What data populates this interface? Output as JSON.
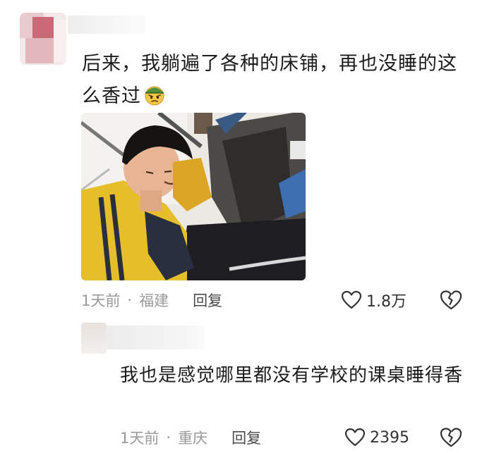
{
  "comment1": {
    "text": "后来，我躺遍了各种的床铺，再也没睡的这么香过",
    "emoji_icon": "smirk-cap-emoji-icon",
    "time": "1天前",
    "location": "福建",
    "reply_label": "回复",
    "like_count": "1.8万"
  },
  "reply1": {
    "text": "我也是感觉哪里都没有学校的课桌睡得香",
    "time": "1天前",
    "location": "重庆",
    "reply_label": "回复",
    "like_count": "2395"
  },
  "separator": "·",
  "colors": {
    "meta_gray": "#9a9a9a",
    "text": "#1c1c1c",
    "icon_stroke": "#333333"
  }
}
